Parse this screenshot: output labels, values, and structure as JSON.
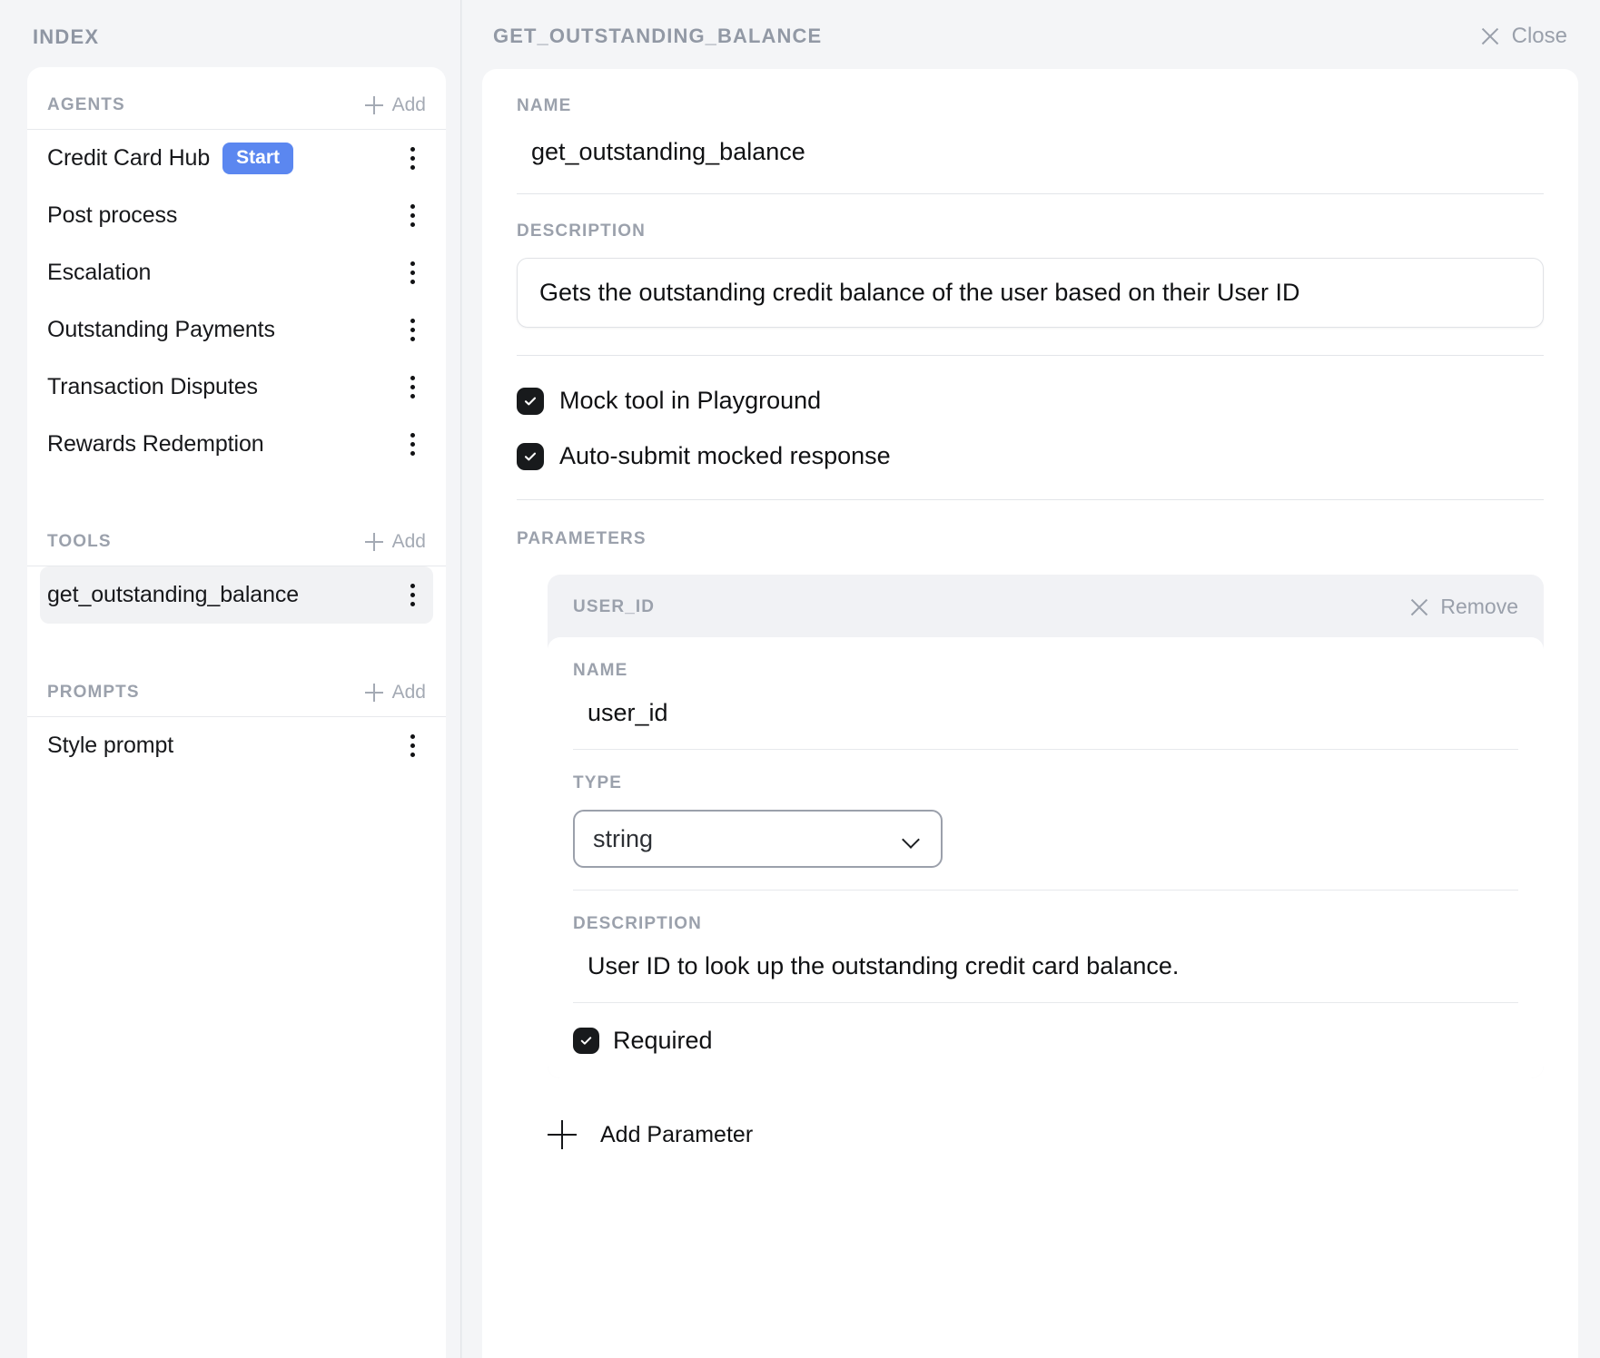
{
  "sidebar": {
    "title": "INDEX",
    "sections": [
      {
        "label": "AGENTS",
        "add_label": "Add",
        "items": [
          {
            "label": "Credit Card Hub",
            "badge": "Start",
            "selected": false
          },
          {
            "label": "Post process",
            "selected": false
          },
          {
            "label": "Escalation",
            "selected": false
          },
          {
            "label": "Outstanding Payments",
            "selected": false
          },
          {
            "label": "Transaction Disputes",
            "selected": false
          },
          {
            "label": "Rewards Redemption",
            "selected": false
          }
        ]
      },
      {
        "label": "TOOLS",
        "add_label": "Add",
        "items": [
          {
            "label": "get_outstanding_balance",
            "selected": true
          }
        ]
      },
      {
        "label": "PROMPTS",
        "add_label": "Add",
        "items": [
          {
            "label": "Style prompt",
            "selected": false
          }
        ]
      }
    ]
  },
  "detail": {
    "header_title": "GET_OUTSTANDING_BALANCE",
    "close_label": "Close",
    "name_label": "NAME",
    "name_value": "get_outstanding_balance",
    "description_label": "DESCRIPTION",
    "description_value": "Gets the outstanding credit balance of the user based on their User ID",
    "options": [
      {
        "label": "Mock tool in Playground",
        "checked": true
      },
      {
        "label": "Auto-submit mocked response",
        "checked": true
      }
    ],
    "parameters_label": "PARAMETERS",
    "parameters": [
      {
        "header": "USER_ID",
        "remove_label": "Remove",
        "name_label": "NAME",
        "name_value": "user_id",
        "type_label": "TYPE",
        "type_value": "string",
        "description_label": "DESCRIPTION",
        "description_value": "User ID to look up the outstanding credit card balance.",
        "required_label": "Required",
        "required_checked": true
      }
    ],
    "add_parameter_label": "Add Parameter"
  },
  "colors": {
    "accent": "#5b87f0",
    "checkbox": "#181a1c",
    "muted": "#9ba1ac",
    "panel_bg": "#f4f5f7"
  }
}
